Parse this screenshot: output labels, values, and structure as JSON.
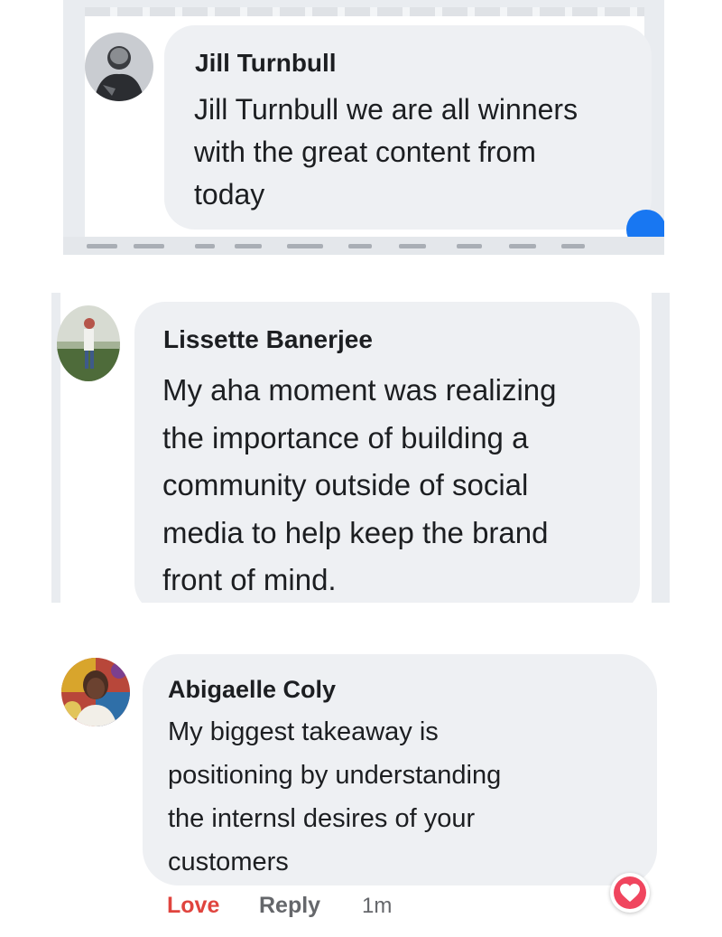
{
  "comments": [
    {
      "author": "Jill Turnbull",
      "lines": [
        "Jill Turnbull we are all winners",
        "with the great content from",
        "today"
      ]
    },
    {
      "author": "Lissette Banerjee",
      "lines": [
        "My aha moment was realizing",
        "the importance of building a",
        "community outside of social",
        "media to help keep the brand",
        "front of mind."
      ]
    },
    {
      "author": "Abigaelle Coly",
      "lines": [
        "My biggest takeaway is",
        "positioning by understanding",
        "the internsl desires of your",
        "customers"
      ],
      "actions": {
        "love": "Love",
        "reply": "Reply",
        "time": "1m"
      },
      "reaction_icon": "heart-icon"
    }
  ],
  "colors": {
    "bubble": "#eef0f3",
    "love": "#e0443e",
    "muted": "#65676b",
    "heart": "#f0455e"
  }
}
